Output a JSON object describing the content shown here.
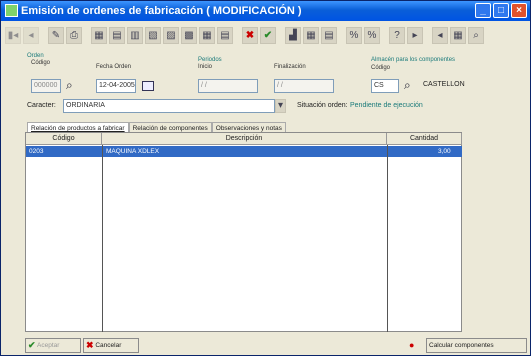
{
  "window": {
    "title": "Emisión de ordenes de fabricación ( MODIFICACIÓN )",
    "controls": [
      "_",
      "□",
      "×"
    ]
  },
  "toolbar": {
    "buttons": [
      {
        "name": "first-record",
        "icon": "▮◂"
      },
      {
        "name": "prev-record",
        "icon": "◂"
      },
      {
        "name": "edit",
        "icon": "✎"
      },
      {
        "name": "print",
        "icon": "⎙"
      },
      {
        "name": "grid-a",
        "icon": "▦"
      },
      {
        "name": "grid-b",
        "icon": "▤"
      },
      {
        "name": "grid-c",
        "icon": "▥"
      },
      {
        "name": "grid-d",
        "icon": "▧"
      },
      {
        "name": "grid-e",
        "icon": "▨"
      },
      {
        "name": "grid-f",
        "icon": "▩"
      },
      {
        "name": "grid-g",
        "icon": "▦"
      },
      {
        "name": "grid-h",
        "icon": "▤"
      },
      {
        "name": "delete",
        "icon": "✖"
      },
      {
        "name": "confirm",
        "icon": "✔"
      },
      {
        "name": "chart",
        "icon": "▟"
      },
      {
        "name": "table-a",
        "icon": "▦"
      },
      {
        "name": "table-b",
        "icon": "▤"
      },
      {
        "name": "calc-a",
        "icon": "%"
      },
      {
        "name": "calc-b",
        "icon": "%"
      },
      {
        "name": "help",
        "icon": "?"
      },
      {
        "name": "nav-a",
        "icon": "▸"
      },
      {
        "name": "nav-b",
        "icon": "◂"
      },
      {
        "name": "grid-i",
        "icon": "▦"
      },
      {
        "name": "search",
        "icon": "⌕"
      }
    ]
  },
  "orden": {
    "group_label": "Orden",
    "codigo_label": "Código",
    "codigo_value": "000000",
    "fecha_label": "Fecha Orden",
    "fecha_value": "12-04-2005"
  },
  "periodos": {
    "group_label": "Periodos",
    "inicio_label": "Inicio",
    "inicio_value": "/ /",
    "finalizacion_label": "Finalización",
    "finalizacion_value": "/ /"
  },
  "almacen": {
    "group_label": "Almacén para los componentes",
    "codigo_label": "Código",
    "codigo_value": "CS",
    "nombre": "CASTELLON"
  },
  "caracter": {
    "label": "Caracter:",
    "value": "ORDINARIA"
  },
  "situacion": {
    "label": "Situación orden:",
    "value": "Pendiente de ejecución"
  },
  "tabs": [
    {
      "label": "Relación de productos a fabricar"
    },
    {
      "label": "Relación de componentes"
    },
    {
      "label": "Observaciones y notas"
    }
  ],
  "grid": {
    "headers": [
      "Código",
      "Descripción",
      "Cantidad"
    ],
    "rows": [
      {
        "codigo": "0203",
        "descripcion": "MAQUINA XDLEX",
        "cantidad": "3,00"
      }
    ]
  },
  "footer": {
    "ok_label": "Aceptar",
    "cancel_label": "Cancelar",
    "calc_label": "Calcular componentes"
  }
}
